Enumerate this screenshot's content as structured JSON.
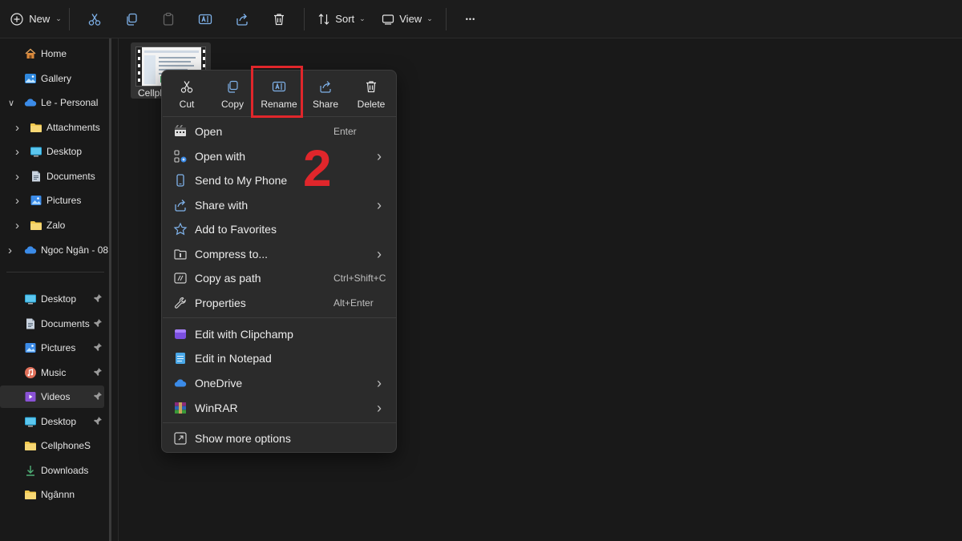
{
  "toolbar": {
    "new_label": "New",
    "sort_label": "Sort",
    "view_label": "View",
    "more_glyph": "•••",
    "chevron": "⌄"
  },
  "sidebar": {
    "tree": [
      {
        "label": "Home",
        "icon": "home-icon"
      },
      {
        "label": "Gallery",
        "icon": "gallery-icon"
      },
      {
        "label": "Le - Personal",
        "icon": "onedrive-cloud-icon"
      },
      {
        "label": "Attachments",
        "icon": "folder-icon"
      },
      {
        "label": "Desktop",
        "icon": "desktop-icon"
      },
      {
        "label": "Documents",
        "icon": "documents-icon"
      },
      {
        "label": "Pictures",
        "icon": "pictures-icon"
      },
      {
        "label": "Zalo",
        "icon": "folder-icon"
      },
      {
        "label": "Ngoc Ngân - 08",
        "icon": "onedrive-cloud-icon"
      }
    ],
    "quick_access": [
      {
        "label": "Desktop",
        "icon": "desktop-icon"
      },
      {
        "label": "Documents",
        "icon": "documents-icon"
      },
      {
        "label": "Pictures",
        "icon": "pictures-icon"
      },
      {
        "label": "Music",
        "icon": "music-icon"
      },
      {
        "label": "Videos",
        "icon": "videos-icon"
      },
      {
        "label": "Desktop",
        "icon": "desktop-icon"
      },
      {
        "label": "CellphoneS",
        "icon": "folder-icon"
      },
      {
        "label": "Downloads",
        "icon": "downloads-icon"
      },
      {
        "label": "Ngânnn",
        "icon": "folder-icon"
      }
    ]
  },
  "file": {
    "name": "Cellpl"
  },
  "context_menu": {
    "quick_actions": [
      {
        "label": "Cut",
        "icon": "scissors-icon"
      },
      {
        "label": "Copy",
        "icon": "copy-icon"
      },
      {
        "label": "Rename",
        "icon": "rename-icon"
      },
      {
        "label": "Share",
        "icon": "share-icon"
      },
      {
        "label": "Delete",
        "icon": "trash-icon"
      }
    ],
    "items": [
      {
        "label": "Open",
        "shortcut": "Enter",
        "icon": "open-file-icon"
      },
      {
        "label": "Open with",
        "arrow": "›",
        "icon": "open-with-icon"
      },
      {
        "label": "Send to My Phone",
        "icon": "phone-icon"
      },
      {
        "label": "Share with",
        "arrow": "›",
        "icon": "share-with-icon"
      },
      {
        "label": "Add to Favorites",
        "icon": "star-icon"
      },
      {
        "label": "Compress to...",
        "arrow": "›",
        "icon": "compress-icon"
      },
      {
        "label": "Copy as path",
        "shortcut": "Ctrl+Shift+C",
        "icon": "copy-path-icon"
      },
      {
        "label": "Properties",
        "shortcut": "Alt+Enter",
        "icon": "wrench-icon"
      },
      {
        "label": "Edit with Clipchamp",
        "icon": "clipchamp-icon"
      },
      {
        "label": "Edit in Notepad",
        "icon": "notepad-icon"
      },
      {
        "label": "OneDrive",
        "arrow": "›",
        "icon": "onedrive-cloud-icon"
      },
      {
        "label": "WinRAR",
        "arrow": "›",
        "icon": "winrar-icon"
      },
      {
        "label": "Show more options",
        "icon": "show-more-icon"
      }
    ]
  },
  "annotation": {
    "step_number": "2"
  },
  "colors": {
    "background": "#191919",
    "menu_bg": "#2b2b2b",
    "highlight_red": "#e0262b",
    "folder_yellow": "#f2c94c",
    "onedrive_blue": "#3b8be8"
  }
}
